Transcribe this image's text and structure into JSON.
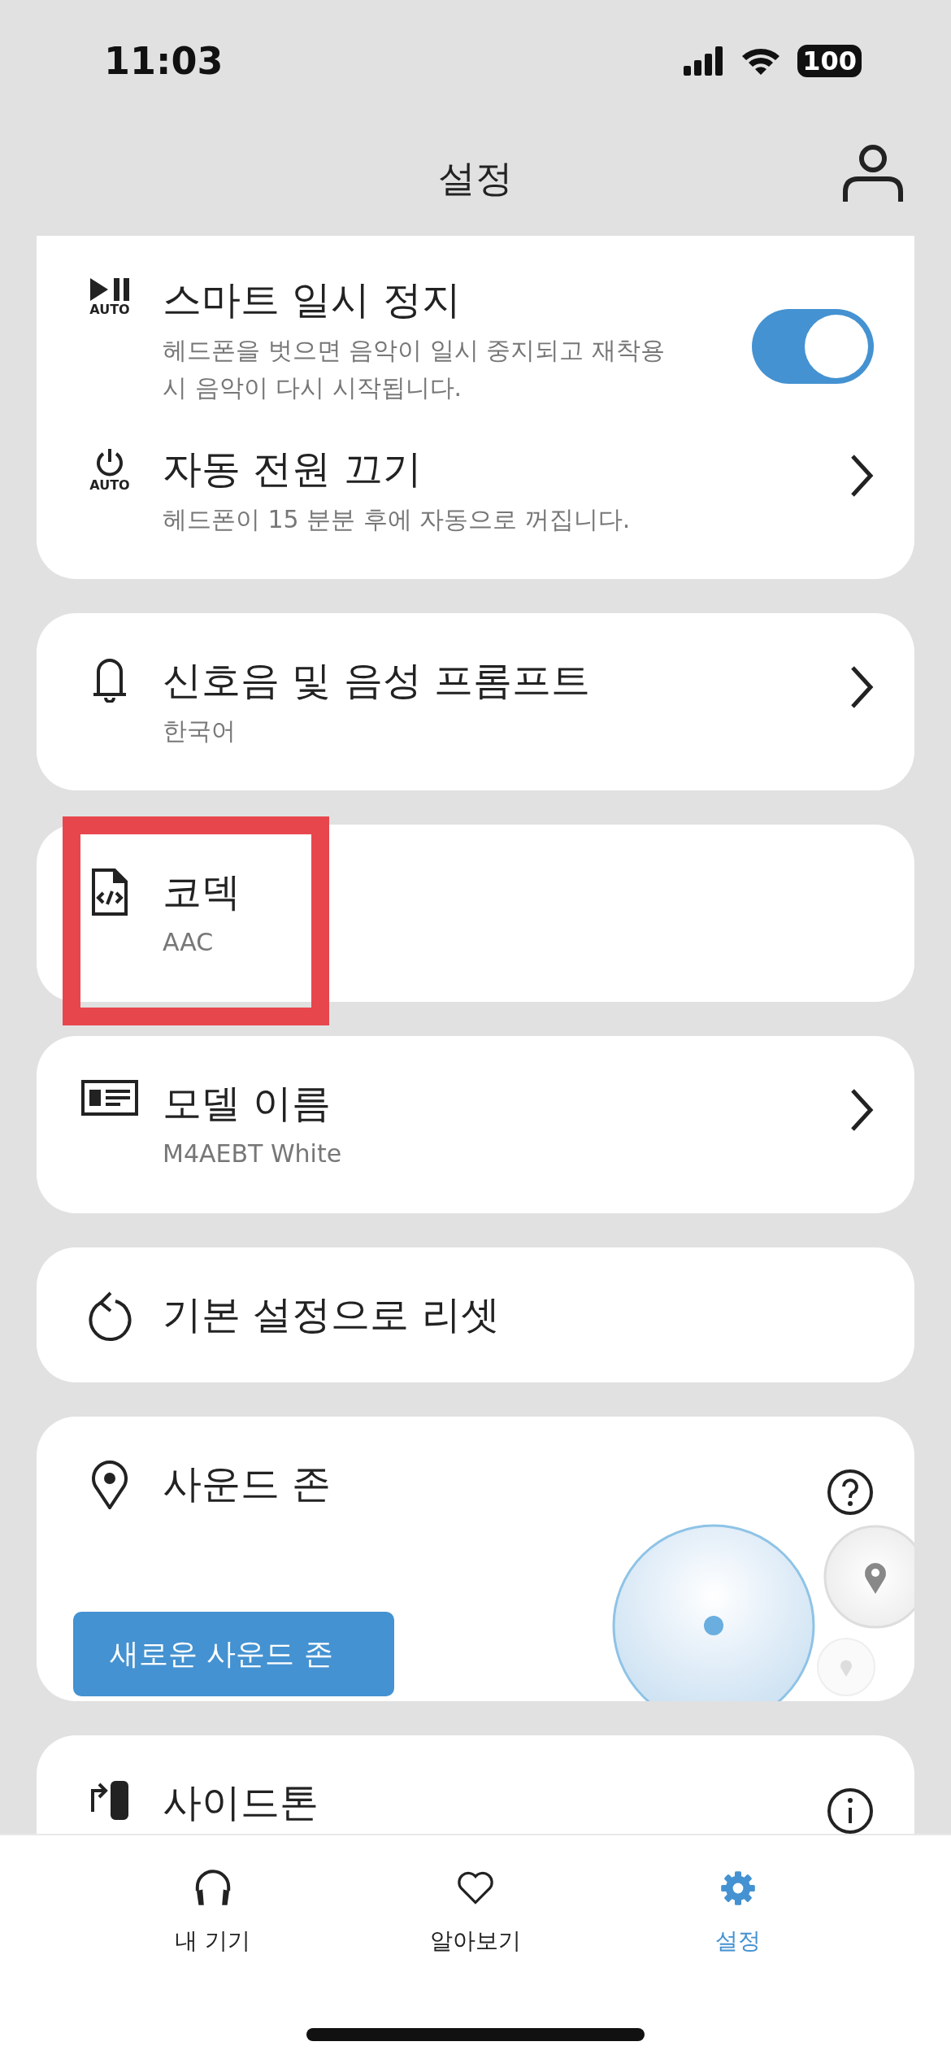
{
  "status_bar": {
    "time": "11:03",
    "battery": "100"
  },
  "header": {
    "title": "설정"
  },
  "sections": [
    {
      "cut_top": true,
      "items": [
        {
          "kind": "toggle",
          "title": "스마트 일시 정지",
          "icon_caption": "AUTO",
          "description": "헤드폰을 벗으면 음악이 일시 중지되고 재착용 시 음악이 다시 시작됩니다.",
          "on": true
        },
        {
          "kind": "link",
          "title": "자동 전원 끄기",
          "icon_caption": "AUTO",
          "description": "헤드폰이 15 분분 후에 자동으로 꺼집니다."
        }
      ]
    },
    {
      "items": [
        {
          "kind": "link",
          "title": "신호음 및 음성 프롬프트",
          "description": "한국어"
        }
      ]
    },
    {
      "items": [
        {
          "kind": "info",
          "title": "코덱",
          "description": "AAC",
          "highlighted": true
        }
      ]
    },
    {
      "items": [
        {
          "kind": "link",
          "title": "모델 이름",
          "description": "M4AEBT White"
        }
      ]
    },
    {
      "items": [
        {
          "kind": "action",
          "title": "기본 설정으로 리셋"
        }
      ]
    },
    {
      "items": [
        {
          "kind": "zone",
          "title": "사운드 존",
          "button": "새로운 사운드 존"
        }
      ]
    },
    {
      "items": [
        {
          "kind": "help",
          "title": "사이드톤"
        }
      ]
    }
  ],
  "tabs": [
    {
      "label": "내 기기",
      "selected": false
    },
    {
      "label": "알아보기",
      "selected": false
    },
    {
      "label": "설정",
      "selected": true
    }
  ]
}
